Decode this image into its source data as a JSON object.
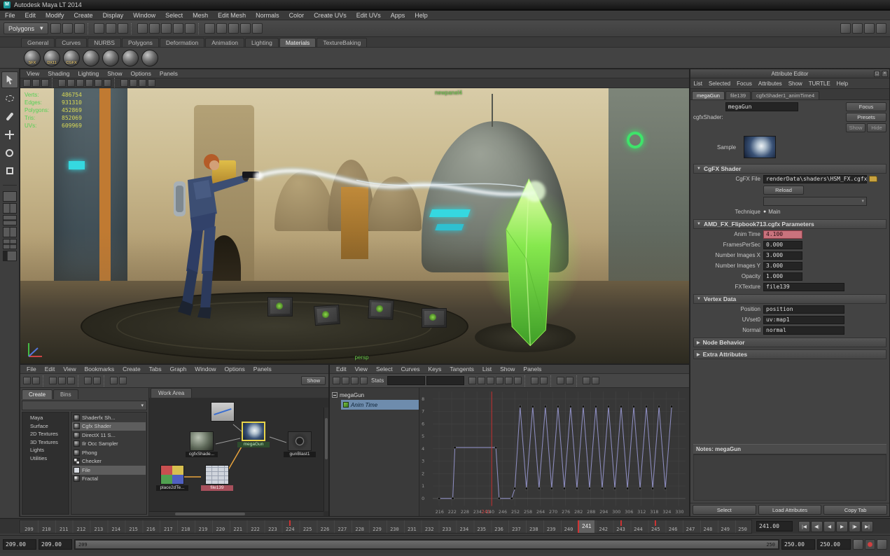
{
  "window": {
    "title": "Autodesk Maya LT 2014"
  },
  "menubar": {
    "items": [
      "File",
      "Edit",
      "Modify",
      "Create",
      "Display",
      "Window",
      "Select",
      "Mesh",
      "Edit Mesh",
      "Normals",
      "Color",
      "Create UVs",
      "Edit UVs",
      "Apps",
      "Help"
    ]
  },
  "statusline": {
    "mode": "Polygons",
    "icons": [
      "new-scene-icon",
      "open-scene-icon",
      "save-scene-icon",
      "separator",
      "select-hierarchy-icon",
      "select-object-icon",
      "select-component-icon",
      "separator",
      "snap-to-grid-icon",
      "snap-to-curve-icon",
      "snap-to-point-icon",
      "snap-to-view-plane-icon",
      "make-live-icon",
      "separator",
      "construction-history-icon",
      "open-render-view-icon",
      "render-current-frame-icon",
      "ipr-render-icon",
      "render-settings-icon"
    ],
    "right_icons": [
      "toggle-attribute-editor-icon",
      "toggle-tool-settings-icon",
      "toggle-channel-box-icon",
      "toggle-outliner-icon"
    ]
  },
  "shelf": {
    "tabs": [
      "General",
      "Curves",
      "NURBS",
      "Polygons",
      "Deformation",
      "Animation",
      "Lighting",
      "Materials",
      "TextureBaking"
    ],
    "active_tab": "Materials",
    "icons": [
      {
        "name": "shaderfx-shelf-icon",
        "label": "SFX"
      },
      {
        "name": "dx11-shader-shelf-icon",
        "label": "DX11"
      },
      {
        "name": "cgfx-shader-shelf-icon",
        "label": "CGFX"
      },
      {
        "name": "blinn-shelf-icon",
        "label": ""
      },
      {
        "name": "phong-shelf-icon",
        "label": ""
      },
      {
        "name": "lambert-shelf-icon",
        "label": ""
      },
      {
        "name": "ramp-shader-shelf-icon",
        "label": ""
      }
    ]
  },
  "toolbox": {
    "tools": [
      "select-tool",
      "lasso-tool",
      "paint-selection-tool",
      "move-tool",
      "rotate-tool",
      "scale-tool"
    ],
    "layouts": [
      "single-pane-layout",
      "two-pane-side-layout",
      "two-pane-stacked-layout",
      "three-pane-split-layout",
      "four-pane-layout",
      "outliner-persp-layout"
    ]
  },
  "viewport": {
    "menus": [
      "View",
      "Shading",
      "Lighting",
      "Show",
      "Options",
      "Panels"
    ],
    "toolbar_icons": [
      "camera-lock-icon",
      "bookmark-icon",
      "image-plane-icon",
      "separator",
      "grid-icon",
      "film-gate-icon",
      "resolution-gate-icon",
      "gate-mask-icon",
      "safe-action-icon",
      "safe-title-icon",
      "separator",
      "wireframe-icon",
      "smooth-shade-icon",
      "textured-icon",
      "use-all-lights-icon"
    ],
    "hud": [
      {
        "label": "Verts:",
        "value": "486754"
      },
      {
        "label": "Edges:",
        "value": "931310"
      },
      {
        "label": "Polygons:",
        "value": "452869"
      },
      {
        "label": "Tris:",
        "value": "852069"
      },
      {
        "label": "UVs:",
        "value": "609969"
      }
    ],
    "panel_label": "newpanel4",
    "camera_label": "persp"
  },
  "hypershade": {
    "menus": [
      "File",
      "Edit",
      "View",
      "Bookmarks",
      "Create",
      "Tabs",
      "Graph",
      "Window",
      "Options",
      "Panels"
    ],
    "toolbar_icons": [
      "previous-graph-icon",
      "next-graph-icon",
      "separator",
      "clear-graph-icon",
      "rearrange-graph-icon",
      "graph-materials-icon",
      "separator",
      "show-top-tabs-icon",
      "show-bottom-tabs-icon",
      "separator",
      "create-render-node-icon",
      "filter-icon"
    ],
    "show_button": "Show",
    "tabs": [
      "Create",
      "Bins"
    ],
    "active_tab": "Create",
    "categories": [
      "Maya",
      "Surface",
      "2D Textures",
      "3D Textures",
      "Lights",
      "Utilities"
    ],
    "node_types": [
      {
        "label": "Shaderfx Sh...",
        "icon": "sphere",
        "selected": false
      },
      {
        "label": "Cgfx Shader",
        "icon": "sphere",
        "selected": true
      },
      {
        "label": "DirectX 11 S...",
        "icon": "sphere",
        "selected": false
      },
      {
        "label": "Ilr Occ Sampler",
        "icon": "sphere",
        "selected": false
      },
      {
        "label": "Phong",
        "icon": "sphere",
        "selected": false
      },
      {
        "label": "Checker",
        "icon": "checker",
        "selected": false
      },
      {
        "label": "File",
        "icon": "file",
        "selected": true
      },
      {
        "label": "Fractal",
        "icon": "fractal",
        "selected": false
      }
    ],
    "work_area_tab": "Work Area",
    "nodes": [
      {
        "label": "cgfxShade..."
      },
      {
        "label": "megaGun"
      },
      {
        "label": "gunBlast1"
      },
      {
        "label": "place2dTe..."
      },
      {
        "label": "file139"
      }
    ]
  },
  "graph_editor": {
    "menus": [
      "Edit",
      "View",
      "Select",
      "Curves",
      "Keys",
      "Tangents",
      "List",
      "Show",
      "Panels"
    ],
    "toolbar_icons_left": [
      "move-nearest-picked-key-icon",
      "insert-keys-icon",
      "add-keys-icon",
      "lattice-deform-keys-icon"
    ],
    "stats_label": "Stats",
    "stats_fields": [
      "",
      ""
    ],
    "toolbar_icons_right": [
      "spline-tangents-icon",
      "clamped-tangents-icon",
      "linear-tangents-icon",
      "flat-tangents-icon",
      "step-tangents-icon",
      "plateau-tangents-icon",
      "separator",
      "buffer-curve-snapshot-icon",
      "swap-buffer-curve-icon",
      "separator",
      "break-tangents-icon",
      "unify-tangents-icon",
      "separator",
      "time-snap-icon",
      "value-snap-icon"
    ],
    "tree": {
      "root": "megaGun",
      "child": "Anim Time"
    },
    "axis": {
      "x_ticks": [
        216,
        222,
        228,
        234,
        240,
        246,
        252,
        258,
        264,
        270,
        276,
        282,
        288,
        294,
        300,
        306,
        312,
        318,
        324,
        330
      ],
      "y_ticks": [
        0,
        1,
        2,
        3,
        4,
        5,
        6,
        7,
        8
      ],
      "x_min": 213,
      "x_max": 333,
      "y_min": -0.6,
      "y_max": 8.6
    },
    "current_frame": 241,
    "current_frame_label": "241",
    "curve_points": [
      [
        216,
        0
      ],
      [
        222.5,
        0
      ],
      [
        223.5,
        4.1
      ],
      [
        243,
        4.1
      ],
      [
        244.5,
        0
      ],
      [
        250.5,
        0
      ],
      [
        252,
        0.8
      ],
      [
        254.5,
        7.4
      ],
      [
        257.5,
        0.8
      ],
      [
        260.5,
        7.4
      ],
      [
        263.5,
        0.8
      ],
      [
        266.5,
        7.4
      ],
      [
        269.5,
        0.8
      ],
      [
        272.5,
        7.4
      ],
      [
        275.5,
        0.8
      ],
      [
        278.5,
        7.4
      ],
      [
        281.5,
        0.8
      ],
      [
        284.5,
        7.4
      ],
      [
        287.5,
        0.8
      ],
      [
        290.5,
        7.4
      ],
      [
        293.5,
        0.8
      ],
      [
        296.5,
        7.4
      ],
      [
        299.5,
        0.8
      ],
      [
        302.5,
        7.4
      ],
      [
        305.5,
        0.8
      ],
      [
        308.5,
        7.4
      ],
      [
        311.5,
        0.8
      ],
      [
        314.5,
        7.4
      ],
      [
        317.5,
        0.8
      ],
      [
        320.5,
        7.4
      ],
      [
        323.5,
        0.8
      ],
      [
        326.5,
        7.4
      ]
    ]
  },
  "attribute_editor": {
    "title": "Attribute Editor",
    "menus": [
      "List",
      "Selected",
      "Focus",
      "Attributes",
      "Show",
      "TURTLE",
      "Help"
    ],
    "tabs": [
      "megaGun",
      "file139",
      "cgfxShader1_animTime4"
    ],
    "active_tab": "megaGun",
    "node_type_label": "cgfxShader:",
    "node_name": "megaGun",
    "focus_button": "Focus",
    "presets_button": "Presets",
    "show_button": "Show",
    "hide_button": "Hide",
    "sample_label": "Sample",
    "cgfx_section": {
      "title": "CgFX Shader",
      "file_label": "CgFX File",
      "file_value": "renderData\\shaders\\HSM_FX.cgfx",
      "reload_button": "Reload",
      "technique_label": "Technique",
      "technique_value": "Main"
    },
    "params_section": {
      "title": "AMD_FX_Flipbook713.cgfx Parameters",
      "rows": [
        {
          "label": "Anim Time",
          "value": "4.100",
          "highlight": true
        },
        {
          "label": "FramesPerSec",
          "value": "0.000"
        },
        {
          "label": "Number Images X",
          "value": "3.000"
        },
        {
          "label": "Number Images Y",
          "value": "3.000"
        },
        {
          "label": "Opacity",
          "value": "1.000"
        },
        {
          "label": "FXTexture",
          "value": "file139",
          "wide": true,
          "connection": true
        }
      ]
    },
    "vertex_section": {
      "title": "Vertex Data",
      "rows": [
        {
          "label": "Position",
          "value": "position"
        },
        {
          "label": "UVset0",
          "value": "uv:map1"
        },
        {
          "label": "Normal",
          "value": "normal"
        }
      ]
    },
    "collapsed_sections": [
      "Node Behavior",
      "Extra Attributes"
    ],
    "notes_label": "Notes: megaGun",
    "buttons": [
      "Select",
      "Load Attributes",
      "Copy Tab"
    ]
  },
  "time_slider": {
    "start": 209,
    "end": 250,
    "current": 241,
    "current_label": "241",
    "current_time_field": "241.00",
    "key_frames": [
      224,
      243,
      245
    ],
    "playback_buttons": [
      {
        "name": "go-to-start-button",
        "glyph": "|◀"
      },
      {
        "name": "step-back-frame-button",
        "glyph": "◀|"
      },
      {
        "name": "play-backwards-button",
        "glyph": "◀"
      },
      {
        "name": "play-forwards-button",
        "glyph": "▶"
      },
      {
        "name": "step-forward-frame-button",
        "glyph": "|▶"
      },
      {
        "name": "go-to-end-button",
        "glyph": "▶|"
      }
    ]
  },
  "range_slider": {
    "anim_start_field": "209.00",
    "play_start_field": "209.00",
    "bar_start_label": "209",
    "bar_end_label": "250",
    "play_end_field": "250.00",
    "anim_end_field": "250.00",
    "icons": [
      "animation-layer-icon",
      "auto-keyframe-icon",
      "animation-preferences-icon"
    ]
  }
}
